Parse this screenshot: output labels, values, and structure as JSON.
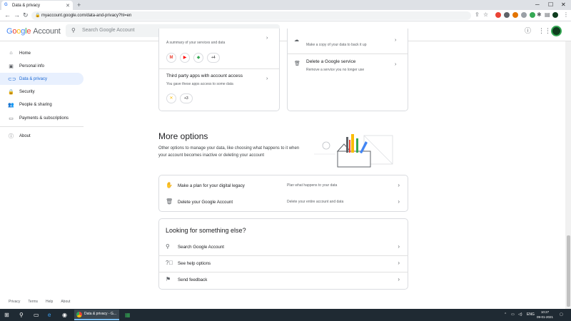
{
  "browser": {
    "tab_title": "Data & privacy",
    "tab_favicon": "G",
    "url": "myaccount.google.com/data-and-privacy?hl=en"
  },
  "header": {
    "logo_letters": [
      "G",
      "o",
      "o",
      "g",
      "l",
      "e"
    ],
    "logo_suffix": "Account",
    "search_placeholder": "Search Google Account"
  },
  "sidebar": {
    "items": [
      {
        "label": "Home",
        "icon": "home-icon"
      },
      {
        "label": "Personal info",
        "icon": "person-card-icon"
      },
      {
        "label": "Data & privacy",
        "icon": "toggle-icon"
      },
      {
        "label": "Security",
        "icon": "lock-icon"
      },
      {
        "label": "People & sharing",
        "icon": "people-icon"
      },
      {
        "label": "Payments & subscriptions",
        "icon": "credit-card-icon"
      },
      {
        "label": "About",
        "icon": "info-icon"
      }
    ],
    "footer_links": [
      "Privacy",
      "Terms",
      "Help",
      "About"
    ]
  },
  "top_cards": {
    "left": {
      "summary_text": "A summary of your services and data",
      "summary_more": "+4",
      "third_party_title": "Third party apps with account access",
      "third_party_desc": "You gave these apps access to some data",
      "third_party_more": "+3"
    },
    "right": {
      "backup_desc": "Make a copy of your data to back it up",
      "delete_service_title": "Delete a Google service",
      "delete_service_desc": "Remove a service you no longer use"
    }
  },
  "more_options": {
    "title": "More options",
    "description": "Other options to manage your data, like choosing what happens to it when your account becomes inactive or deleting your account",
    "rows": [
      {
        "label": "Make a plan for your digital legacy",
        "desc": "Plan what happens to your data",
        "icon": "hand-icon"
      },
      {
        "label": "Delete your Google Account",
        "desc": "Delete your entire account and data",
        "icon": "trash-icon"
      }
    ]
  },
  "looking": {
    "title": "Looking for something else?",
    "rows": [
      {
        "label": "Search Google Account",
        "icon": "search-icon"
      },
      {
        "label": "See help options",
        "icon": "help-icon"
      },
      {
        "label": "Send feedback",
        "icon": "feedback-icon"
      }
    ]
  },
  "taskbar": {
    "active_app": "Data & privacy - G...",
    "language": "ENG",
    "time": "10:27",
    "date": "09-01-2021"
  }
}
